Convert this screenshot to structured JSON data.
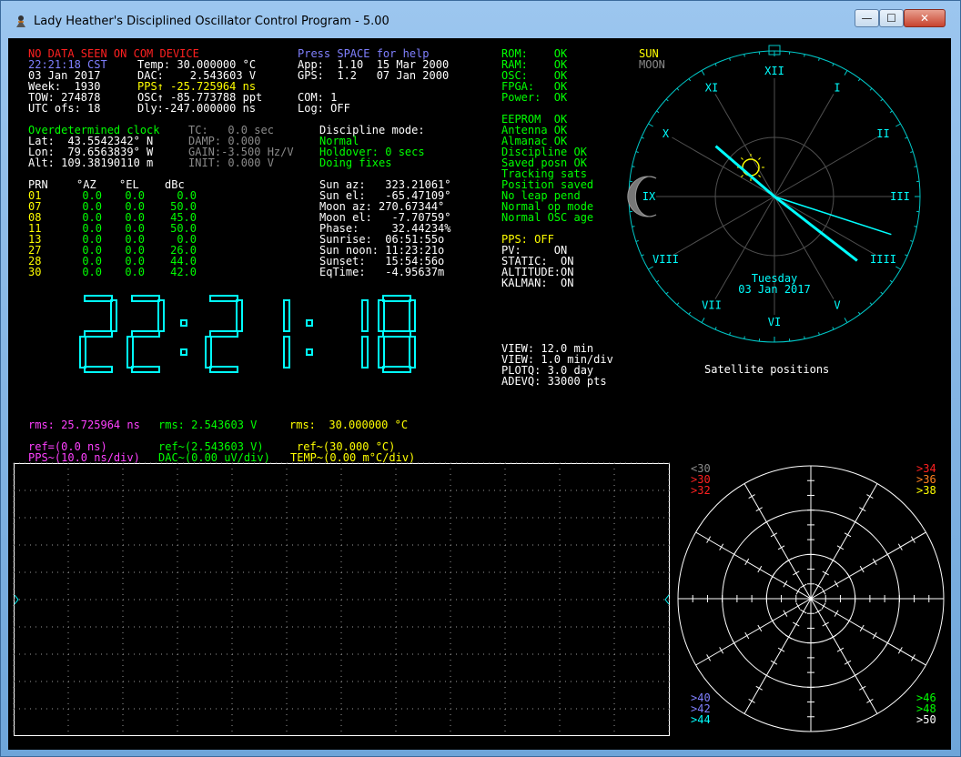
{
  "window": {
    "title": "Lady Heather's Disciplined Oscillator Control Program - 5.00",
    "min_glyph": "—",
    "max_glyph": "☐",
    "close_glyph": "✕"
  },
  "status": {
    "no_data": "NO DATA SEEN ON COM DEVICE",
    "help": "Press SPACE for help",
    "time": "22:21:18 CST",
    "date": "03 Jan 2017",
    "week": "Week:  1930",
    "tow": "TOW: 274878",
    "utc_ofs": "UTC ofs: 18",
    "temp": "Temp: 30.000000 °C",
    "dac": "DAC:    2.543603 V",
    "pps": "PPS↑ -25.725964 ns",
    "osc": "OSC↑ -85.773788 ppt",
    "dly": "Dly:-247.000000 ns",
    "app": "App:  1.10  15 Mar 2000",
    "gps": "GPS:  1.2   07 Jan 2000",
    "com": "COM: 1",
    "log": "Log: OFF"
  },
  "self_test": {
    "rows": [
      "ROM:    OK",
      "RAM:    OK",
      "OSC:    OK",
      "FPGA:   OK",
      "Power:  OK"
    ],
    "rows2": [
      "EEPROM  OK",
      "Antenna OK",
      "Almanac OK",
      "Discipline OK",
      "Saved posn OK",
      "Tracking sats",
      "Position saved",
      "No leap pend",
      "Normal op mode",
      "Normal OSC age"
    ],
    "pps_off": "PPS: OFF",
    "flags": [
      "PV:     ON",
      "STATIC:  ON",
      "ALTITUDE:ON",
      "KALMAN:  ON"
    ]
  },
  "position": {
    "title": "Overdetermined clock",
    "lat": "Lat:  43.5542342° N",
    "lon": "Lon:  79.6563839° W",
    "alt": "Alt: 109.38190110 m",
    "tc": "TC:   0.0 sec",
    "damp": "DAMP: 0.000",
    "gain": "GAIN:-3.500 Hz/V",
    "init": "INIT: 0.000 V"
  },
  "discipline": {
    "label": "Discipline mode:",
    "mode": "Normal",
    "holdover": "Holdover: 0 secs",
    "fixes": "Doing fixes"
  },
  "satellites": {
    "headers": [
      "PRN",
      "°AZ",
      "°EL",
      "dBc"
    ],
    "rows": [
      [
        "01",
        "0.0",
        "0.0",
        "0.0"
      ],
      [
        "07",
        "0.0",
        "0.0",
        "50.0"
      ],
      [
        "08",
        "0.0",
        "0.0",
        "45.0"
      ],
      [
        "11",
        "0.0",
        "0.0",
        "50.0"
      ],
      [
        "13",
        "0.0",
        "0.0",
        "0.0"
      ],
      [
        "27",
        "0.0",
        "0.0",
        "26.0"
      ],
      [
        "28",
        "0.0",
        "0.0",
        "44.0"
      ],
      [
        "30",
        "0.0",
        "0.0",
        "42.0"
      ]
    ]
  },
  "astro": [
    "Sun az:   323.21061°",
    "Sun el:   -65.47109°",
    "Moon az: 270.67344°",
    "Moon el:   -7.70759°",
    "Phase:     32.44234%",
    "Sunrise:  06:51:55o",
    "Sun noon: 11:23:21o",
    "Sunset:   15:54:56o",
    "EqTime:   -4.95637m"
  ],
  "big_clock": "22:21:18",
  "view": [
    "VIEW: 12.0 min",
    "VIEW: 1.0 min/div",
    "PLOTQ: 3.0 day",
    "ADEVQ: 33000 pts"
  ],
  "clock_face": {
    "numerals": [
      "XII",
      "I",
      "II",
      "III",
      "IIII",
      "V",
      "VI",
      "VII",
      "VIII",
      "IX",
      "X",
      "XI"
    ],
    "day": "Tuesday",
    "date": "03 Jan 2017",
    "legend_sun": "SUN",
    "legend_moon": "MOON",
    "caption": "Satellite positions",
    "hour": 10.355,
    "minute": 21.3,
    "second": 18,
    "colors": {
      "ring": "#00c8c8",
      "hand": "#00ffff",
      "numeral": "#00ffff"
    }
  },
  "rms": {
    "pps": "rms: 25.725964 ns",
    "dac": "rms: 2.543603 V",
    "temp": "rms:  30.000000 °C"
  },
  "plot_legend": {
    "ref_pps": "ref=(0.0 ns)",
    "ref_dac": "ref~(2.543603 V)",
    "ref_temp": "ref~(30.000 °C)",
    "pps_scale": "PPS~(10.0 ns/div)",
    "dac_scale": "DAC~(0.00 uV/div)",
    "temp_scale": "TEMP~(0.00 m°C/div)"
  },
  "azel": {
    "tl": [
      "<30",
      ">30",
      ">32"
    ],
    "tr": [
      ">34",
      ">36",
      ">38"
    ],
    "bl": [
      ">40",
      ">42",
      ">44"
    ],
    "br": [
      ">46",
      ">48",
      ">50"
    ]
  }
}
